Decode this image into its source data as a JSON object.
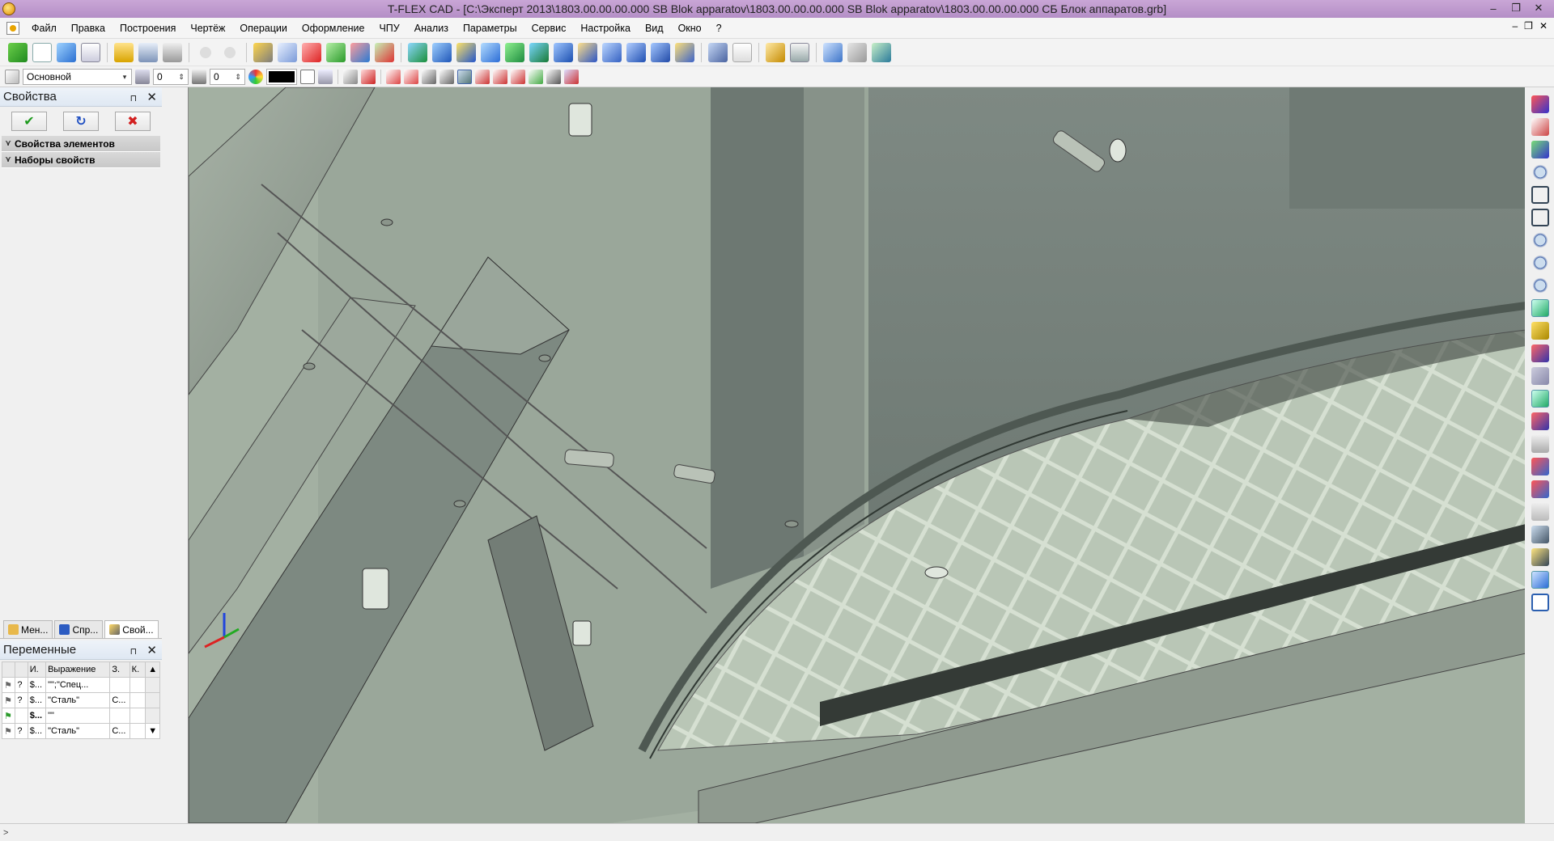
{
  "window": {
    "title": "T-FLEX CAD - [C:\\Эксперт 2013\\1803.00.00.00.000 SB Blok apparatov\\1803.00.00.00.000 SB Blok apparatov\\1803.00.00.00.000 СБ Блок аппаратов.grb]",
    "minimize": "–",
    "restore": "❐",
    "close": "✕"
  },
  "menu": {
    "items": [
      "Файл",
      "Правка",
      "Построения",
      "Чертёж",
      "Операции",
      "Оформление",
      "ЧПУ",
      "Анализ",
      "Параметры",
      "Сервис",
      "Настройка",
      "Вид",
      "Окно",
      "?"
    ],
    "mdi_minimize": "–",
    "mdi_restore": "❐",
    "mdi_close": "✕"
  },
  "toolbar2": {
    "layer": "Основной",
    "level": "0",
    "priority": "0",
    "color": "#000000"
  },
  "properties_panel": {
    "title": "Свойства",
    "pin": "⊓",
    "close": "✕",
    "ok": "✔",
    "refresh": "↻",
    "cancel": "✖",
    "sections": [
      "Свойства элементов",
      "Наборы свойств"
    ]
  },
  "bottom_tabs": [
    "Мен...",
    "Спр...",
    "Свой..."
  ],
  "variables_panel": {
    "title": "Переменные",
    "pin": "⊓",
    "close": "✕",
    "columns": [
      "",
      "",
      "И.",
      "Выражение",
      "З.",
      "К."
    ],
    "rows": [
      [
        "",
        "?",
        "$...",
        "\"\";\"Спец...",
        "",
        ""
      ],
      [
        "",
        "?",
        "$...",
        "\"Сталь\"",
        "С...",
        ""
      ],
      [
        "",
        "",
        "$...",
        "\"\"",
        "",
        ""
      ],
      [
        "",
        "?",
        "$...",
        "\"Сталь\"",
        "С...",
        ""
      ]
    ]
  },
  "status": {
    "text": ">"
  },
  "colors": {
    "titlebar": "#b890c8",
    "viewport_bg": "#9aa79a",
    "steel_light": "#b7c2b4",
    "steel_dark": "#6f7a72"
  }
}
